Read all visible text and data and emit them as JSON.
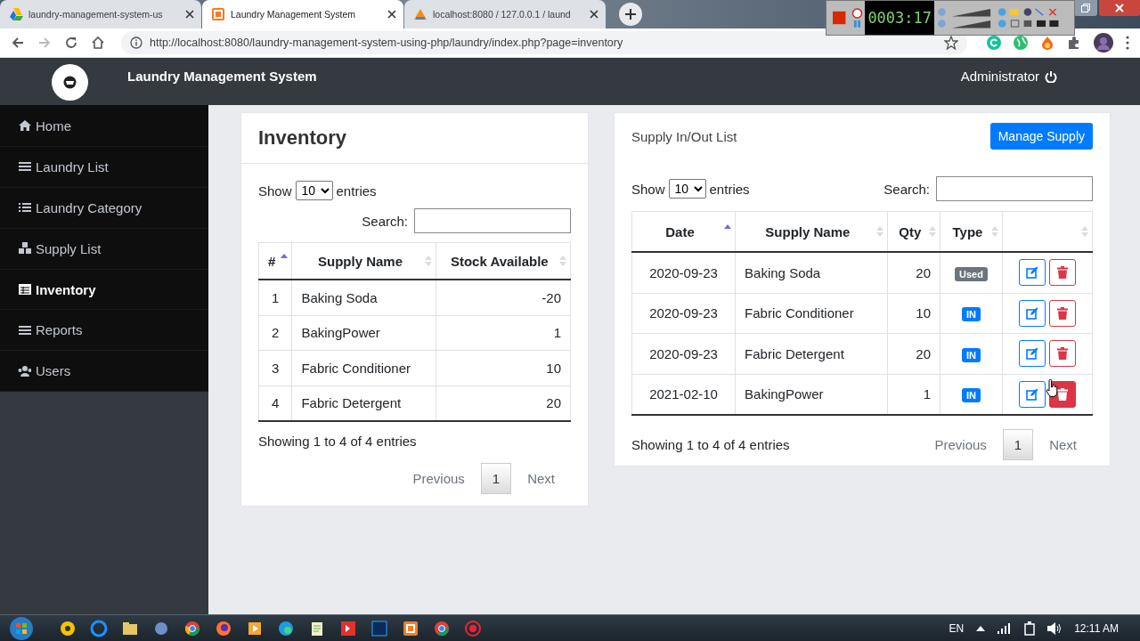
{
  "browser": {
    "tabs": [
      {
        "title": "laundry-management-system-us",
        "selected": false
      },
      {
        "title": "Laundry Management System",
        "selected": true
      },
      {
        "title": "localhost:8080 / 127.0.0.1 / laund",
        "selected": false
      }
    ],
    "url": "http://localhost:8080/laundry-management-system-using-php/laundry/index.php?page=inventory"
  },
  "recorder": {
    "timer": "0003:17"
  },
  "app": {
    "title": "Laundry Management System",
    "user": "Administrator"
  },
  "sidebar": {
    "items": [
      {
        "label": "Home",
        "selected": false
      },
      {
        "label": "Laundry List",
        "selected": false
      },
      {
        "label": "Laundry Category",
        "selected": false
      },
      {
        "label": "Supply List",
        "selected": false
      },
      {
        "label": "Inventory",
        "selected": true
      },
      {
        "label": "Reports",
        "selected": false
      },
      {
        "label": "Users",
        "selected": false
      }
    ]
  },
  "inventory": {
    "title": "Inventory",
    "show_label": "Show",
    "entries_value": "10",
    "entries_label": "entries",
    "search_label": "Search:",
    "columns": [
      {
        "label": "#",
        "sorted": true
      },
      {
        "label": "Supply Name",
        "sorted": false
      },
      {
        "label": "Stock Available",
        "sorted": false
      }
    ],
    "rows": [
      [
        "1",
        "Baking Soda",
        "-20"
      ],
      [
        "2",
        "BakingPower",
        "1"
      ],
      [
        "3",
        "Fabric Conditioner",
        "10"
      ],
      [
        "4",
        "Fabric Detergent",
        "20"
      ]
    ],
    "info": "Showing 1 to 4 of 4 entries",
    "pagination": {
      "previous": "Previous",
      "pages": [
        {
          "label": "1",
          "selected": true
        }
      ],
      "next": "Next"
    }
  },
  "supply": {
    "title": "Supply In/Out List",
    "button": "Manage Supply",
    "show_label": "Show",
    "entries_value": "10",
    "entries_label": "entries",
    "search_label": "Search:",
    "columns": [
      {
        "label": "Date",
        "sorted": true
      },
      {
        "label": "Supply Name",
        "sorted": false
      },
      {
        "label": "Qty",
        "sorted": false
      },
      {
        "label": "Type",
        "sorted": false
      },
      {
        "sorted": false
      }
    ],
    "rows": [
      {
        "date": "2020-09-23",
        "name": "Baking Soda",
        "qty": "20",
        "type": {
          "label": "Used",
          "kind": "used"
        },
        "delete_hovered": false
      },
      {
        "date": "2020-09-23",
        "name": "Fabric Conditioner",
        "qty": "10",
        "type": {
          "label": "IN",
          "kind": "in"
        },
        "delete_hovered": false
      },
      {
        "date": "2020-09-23",
        "name": "Fabric Detergent",
        "qty": "20",
        "type": {
          "label": "IN",
          "kind": "in"
        },
        "delete_hovered": false
      },
      {
        "date": "2021-02-10",
        "name": "BakingPower",
        "qty": "1",
        "type": {
          "label": "IN",
          "kind": "in"
        },
        "delete_hovered": true
      }
    ],
    "info": "Showing 1 to 4 of 4 entries",
    "pagination": {
      "previous": "Previous",
      "pages": [
        {
          "label": "1",
          "selected": true
        }
      ],
      "next": "Next"
    }
  },
  "taskbar": {
    "language": "EN",
    "time": "12:11 AM"
  }
}
